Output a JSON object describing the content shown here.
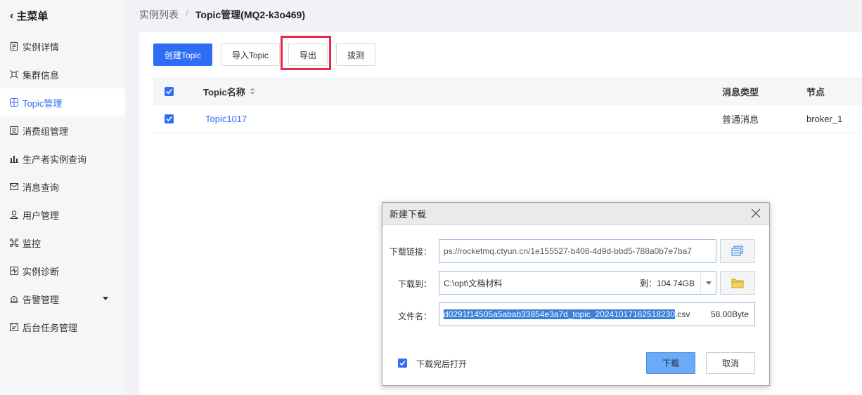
{
  "sidebar": {
    "back_label": "主菜单",
    "items": [
      {
        "label": "实例详情",
        "icon": "document-icon",
        "active": false
      },
      {
        "label": "集群信息",
        "icon": "cluster-icon",
        "active": false
      },
      {
        "label": "Topic管理",
        "icon": "topic-icon",
        "active": true
      },
      {
        "label": "消费组管理",
        "icon": "consumer-group-icon",
        "active": false
      },
      {
        "label": "生产者实例查询",
        "icon": "bar-chart-icon",
        "active": false
      },
      {
        "label": "消息查询",
        "icon": "message-icon",
        "active": false
      },
      {
        "label": "用户管理",
        "icon": "user-icon",
        "active": false
      },
      {
        "label": "监控",
        "icon": "monitor-icon",
        "active": false
      },
      {
        "label": "实例诊断",
        "icon": "diagnosis-icon",
        "active": false
      },
      {
        "label": "告警管理",
        "icon": "alarm-icon",
        "active": false
      },
      {
        "label": "后台任务管理",
        "icon": "task-icon",
        "active": false
      }
    ]
  },
  "breadcrumb": {
    "parent": "实例列表",
    "separator": "/",
    "current": "Topic管理(MQ2-k3o469)"
  },
  "toolbar": {
    "create_label": "创建Topic",
    "import_label": "导入Topic",
    "export_label": "导出",
    "probe_label": "拨测"
  },
  "table": {
    "headers": {
      "name": "Topic名称",
      "type": "消息类型",
      "node": "节点"
    },
    "rows": [
      {
        "name": "Topic1017",
        "type": "普通消息",
        "node": "broker_1",
        "checked": true
      }
    ]
  },
  "dialog": {
    "title": "新建下载",
    "url_label": "下载链接：",
    "url_value": "ps://rocketmq.ctyun.cn/1e155527-b408-4d9d-bbd5-788a0b7e7ba7",
    "path_label": "下载到：",
    "path_value": "C:\\opt\\文档材料",
    "free_space": "剩：104.74GB",
    "filename_label": "文件名：",
    "filename_selected": "d0291f14505a5abab33854e3a7d_topic_20241017162518230",
    "filename_ext": ".csv",
    "file_size": "58.00Byte",
    "open_after_label": "下载完后打开",
    "download_label": "下载",
    "cancel_label": "取消"
  },
  "colors": {
    "accent": "#2f6df6",
    "highlight_border": "#e8294a",
    "dialog_primary": "#6aaaf6"
  }
}
